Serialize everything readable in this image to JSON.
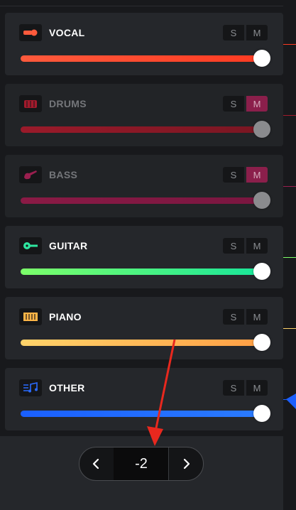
{
  "tracks": [
    {
      "name": "VOCAL",
      "icon": "microphone-icon",
      "solo_label": "S",
      "mute_label": "M",
      "muted": false,
      "level": 1.0,
      "colors": [
        "#ff5a3c",
        "#ff3b22"
      ],
      "icon_color": "#ff5a3c",
      "side_line": "#ff3b22"
    },
    {
      "name": "DRUMS",
      "icon": "drum-icon",
      "solo_label": "S",
      "mute_label": "M",
      "muted": true,
      "level": 1.0,
      "colors": [
        "#9a1a2a",
        "#7a1622"
      ],
      "icon_color": "#a21a2c",
      "side_line": "#a21a2c"
    },
    {
      "name": "BASS",
      "icon": "bass-guitar-icon",
      "solo_label": "S",
      "mute_label": "M",
      "muted": true,
      "level": 1.0,
      "colors": [
        "#8a1a45",
        "#7a1640"
      ],
      "icon_color": "#9a1f4f",
      "side_line": "#9a1f4f"
    },
    {
      "name": "GUITAR",
      "icon": "guitar-icon",
      "solo_label": "S",
      "mute_label": "M",
      "muted": false,
      "level": 1.0,
      "colors": [
        "#7dff6a",
        "#18e69a"
      ],
      "icon_color": "#2ee6a0",
      "side_line": "#7dff6a"
    },
    {
      "name": "PIANO",
      "icon": "piano-icon",
      "solo_label": "S",
      "mute_label": "M",
      "muted": false,
      "level": 1.0,
      "colors": [
        "#ffd36a",
        "#ff9f45"
      ],
      "icon_color": "#ffb547",
      "side_line": "#ffd36a"
    },
    {
      "name": "OTHER",
      "icon": "music-notes-icon",
      "solo_label": "S",
      "mute_label": "M",
      "muted": false,
      "level": 1.0,
      "colors": [
        "#1a5fff",
        "#2a7bff"
      ],
      "icon_color": "#2a6bff",
      "side_line": "#1a5fff"
    }
  ],
  "pager": {
    "value": "-2",
    "prev_icon": "chevron-left-icon",
    "next_icon": "chevron-right-icon"
  },
  "annotation_color": "#e8281e"
}
